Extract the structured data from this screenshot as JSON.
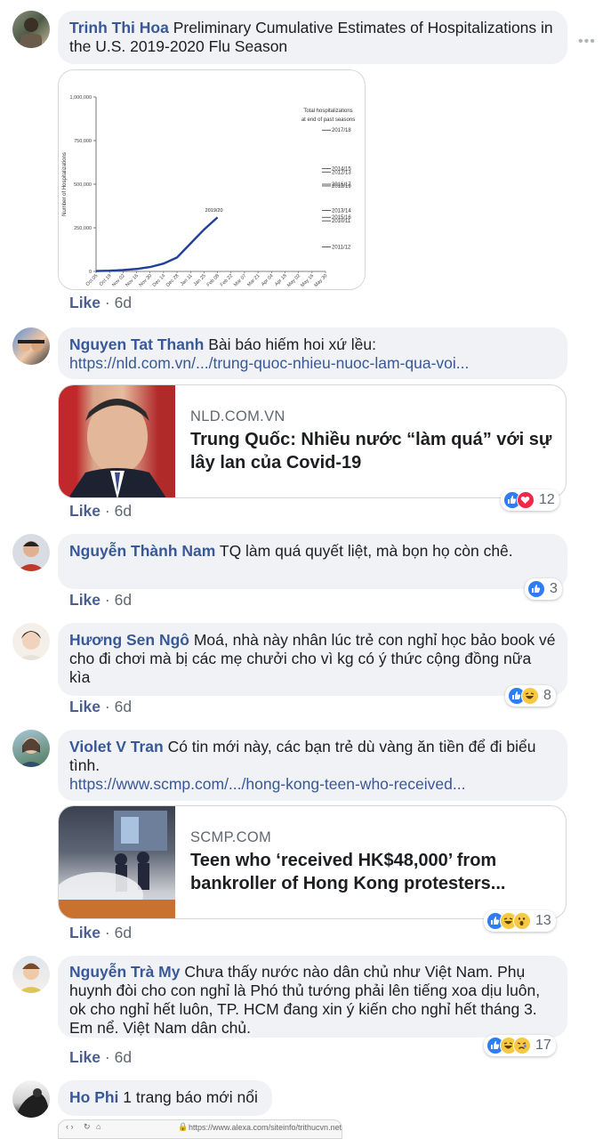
{
  "comments": [
    {
      "name": "Trinh Thi Hoa",
      "text": "Preliminary Cumulative Estimates of Hospitalizations in the U.S. 2019-2020 Flu Season",
      "like": "Like",
      "time": "6d"
    },
    {
      "name": "Nguyen Tat Thanh",
      "text": "Bài báo hiếm hoi xứ lều:",
      "link": "https://nld.com.vn/.../trung-quoc-nhieu-nuoc-lam-qua-voi...",
      "card": {
        "site": "NLD.COM.VN",
        "title": "Trung Quốc: Nhiều nước “làm quá” với sự lây lan của Covid-19"
      },
      "reactions": {
        "icons": [
          "like-reaction-icon",
          "love-reaction-icon"
        ],
        "count": "12"
      },
      "like": "Like",
      "time": "6d"
    },
    {
      "name": "Nguyễn Thành Nam",
      "text": "TQ làm quá quyết liệt, mà bọn họ còn chê.",
      "reactions": {
        "icons": [
          "like-reaction-icon"
        ],
        "count": "3"
      },
      "like": "Like",
      "time": "6d"
    },
    {
      "name": "Hương Sen Ngô",
      "text": "Moá, nhà này nhân lúc trẻ con nghỉ học bảo book vé cho đi chơi mà bị các mẹ chưởi cho vì kg có ý thức cộng đồng nữa kìa",
      "reactions": {
        "icons": [
          "like-reaction-icon",
          "haha-reaction-icon"
        ],
        "count": "8"
      },
      "like": "Like",
      "time": "6d"
    },
    {
      "name": "Violet V Tran",
      "text": "Có tin mới này, các bạn trẻ dù vàng ăn tiền để đi biểu tình.",
      "link": "https://www.scmp.com/.../hong-kong-teen-who-received...",
      "card": {
        "site": "SCMP.COM",
        "title": "Teen who ‘received HK$48,000’ from bankroller of Hong Kong protesters..."
      },
      "reactions": {
        "icons": [
          "like-reaction-icon",
          "haha-reaction-icon",
          "wow-reaction-icon"
        ],
        "count": "13"
      },
      "like": "Like",
      "time": "6d"
    },
    {
      "name": "Nguyễn Trà My",
      "text": "Chưa thấy nước nào dân chủ như Việt Nam. Phụ huynh đòi cho con nghỉ là Phó thủ tướng phải lên tiếng xoa dịu luôn, ok cho nghỉ hết luôn, TP. HCM đang xin ý kiến cho nghỉ hết tháng 3. Em nể. Việt Nam dân chủ.",
      "reactions": {
        "icons": [
          "like-reaction-icon",
          "haha-reaction-icon",
          "sad-reaction-icon"
        ],
        "count": "17"
      },
      "like": "Like",
      "time": "6d"
    },
    {
      "name": "Ho Phi",
      "text": "1 trang báo mới nổi",
      "screenshot_url": "https://www.alexa.com/siteinfo/trithucvn.net#section"
    }
  ],
  "chart_data": {
    "type": "line",
    "title": "",
    "ylabel": "Number of Hospitalizations",
    "xlabel": "",
    "ylim": [
      0,
      1000000
    ],
    "y_ticks": [
      "0",
      "250,000",
      "500,000",
      "750,000",
      "1,000,000"
    ],
    "categories": [
      "Oct 05",
      "Oct 19",
      "Nov 02",
      "Nov 16",
      "Nov 30",
      "Dec 14",
      "Dec 28",
      "Jan 11",
      "Jan 25",
      "Feb 08",
      "Feb 22",
      "Mar 07",
      "Mar 21",
      "Apr 04",
      "Apr 18",
      "May 02",
      "May 16",
      "May 30"
    ],
    "legend_title": "Total hospitalizations at end of past seasons",
    "series": [
      {
        "name": "2019/20",
        "x": [
          "Oct 05",
          "Oct 19",
          "Nov 02",
          "Nov 16",
          "Nov 30",
          "Dec 14",
          "Dec 28",
          "Jan 11",
          "Jan 25",
          "Feb 08"
        ],
        "values": [
          2000,
          4000,
          8000,
          14000,
          25000,
          45000,
          80000,
          160000,
          240000,
          310000
        ]
      }
    ],
    "reference_lines": [
      {
        "name": "2017/18",
        "value": 810000
      },
      {
        "name": "2014/15",
        "value": 590000
      },
      {
        "name": "2012/13",
        "value": 570000
      },
      {
        "name": "2016/17",
        "value": 500000
      },
      {
        "name": "2018/19",
        "value": 490000
      },
      {
        "name": "2013/14",
        "value": 350000
      },
      {
        "name": "2015/16",
        "value": 310000
      },
      {
        "name": "2010/11",
        "value": 290000
      },
      {
        "name": "2011/12",
        "value": 140000
      }
    ]
  }
}
